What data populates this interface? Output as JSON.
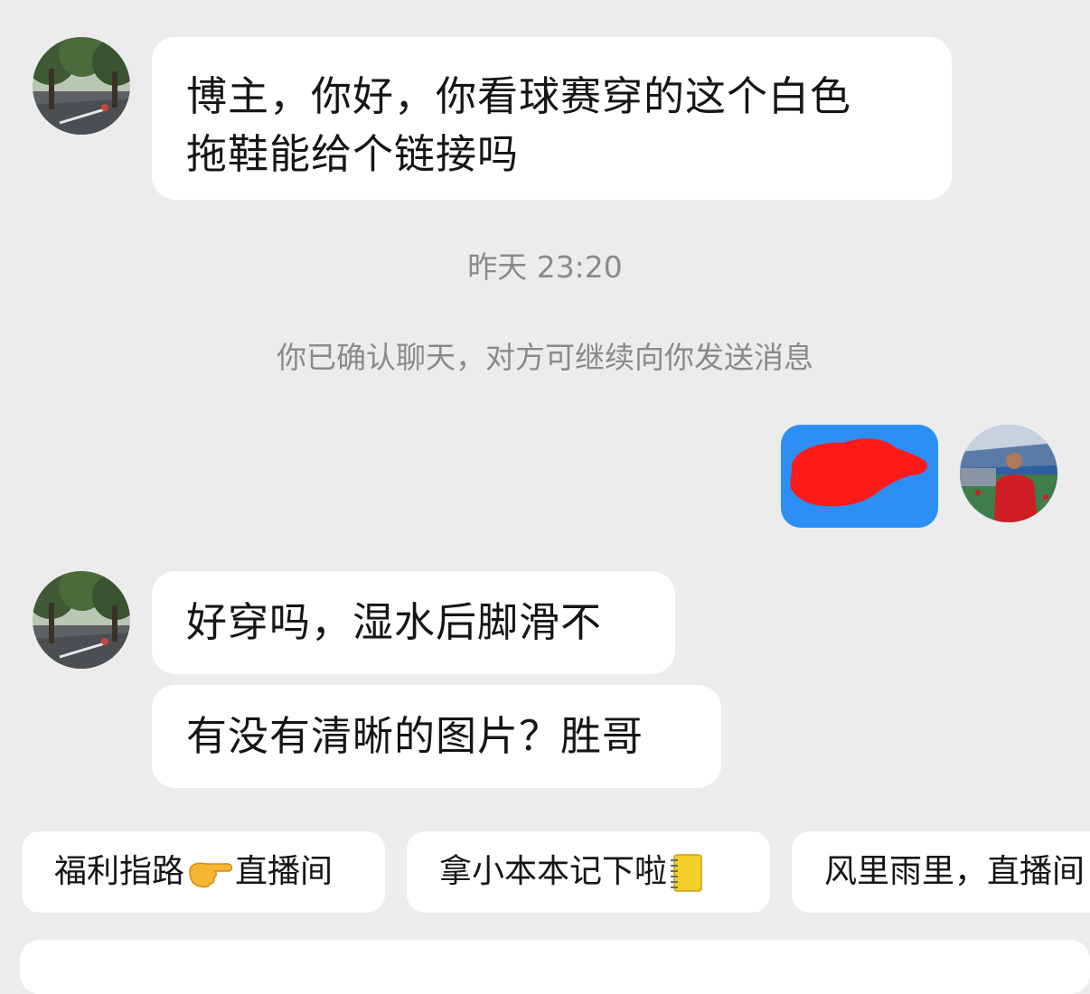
{
  "messages": {
    "first": {
      "line1": "博主，你好，你看球赛穿的这个白色",
      "line2": "拖鞋能给个链接吗"
    },
    "timestamp": "昨天 23:20",
    "system_note": "你已确认聊天，对方可继续向你发送消息",
    "second": "好穿吗，湿水后脚滑不",
    "third": "有没有清晰的图片？胜哥"
  },
  "quick_replies": {
    "item1_text_a": "福利指路",
    "item1_text_b": "直播间",
    "item1_icon": "pointing-hand-icon",
    "item2_text": "拿小本本记下啦",
    "item2_icon": "notebook-icon",
    "item3_text": "风里雨里，直播间"
  },
  "colors": {
    "background": "#ececec",
    "bubble_received": "#ffffff",
    "bubble_sent": "#2b8ff5",
    "redaction": "#ff1a1a",
    "meta_text": "#8a8a8a"
  }
}
